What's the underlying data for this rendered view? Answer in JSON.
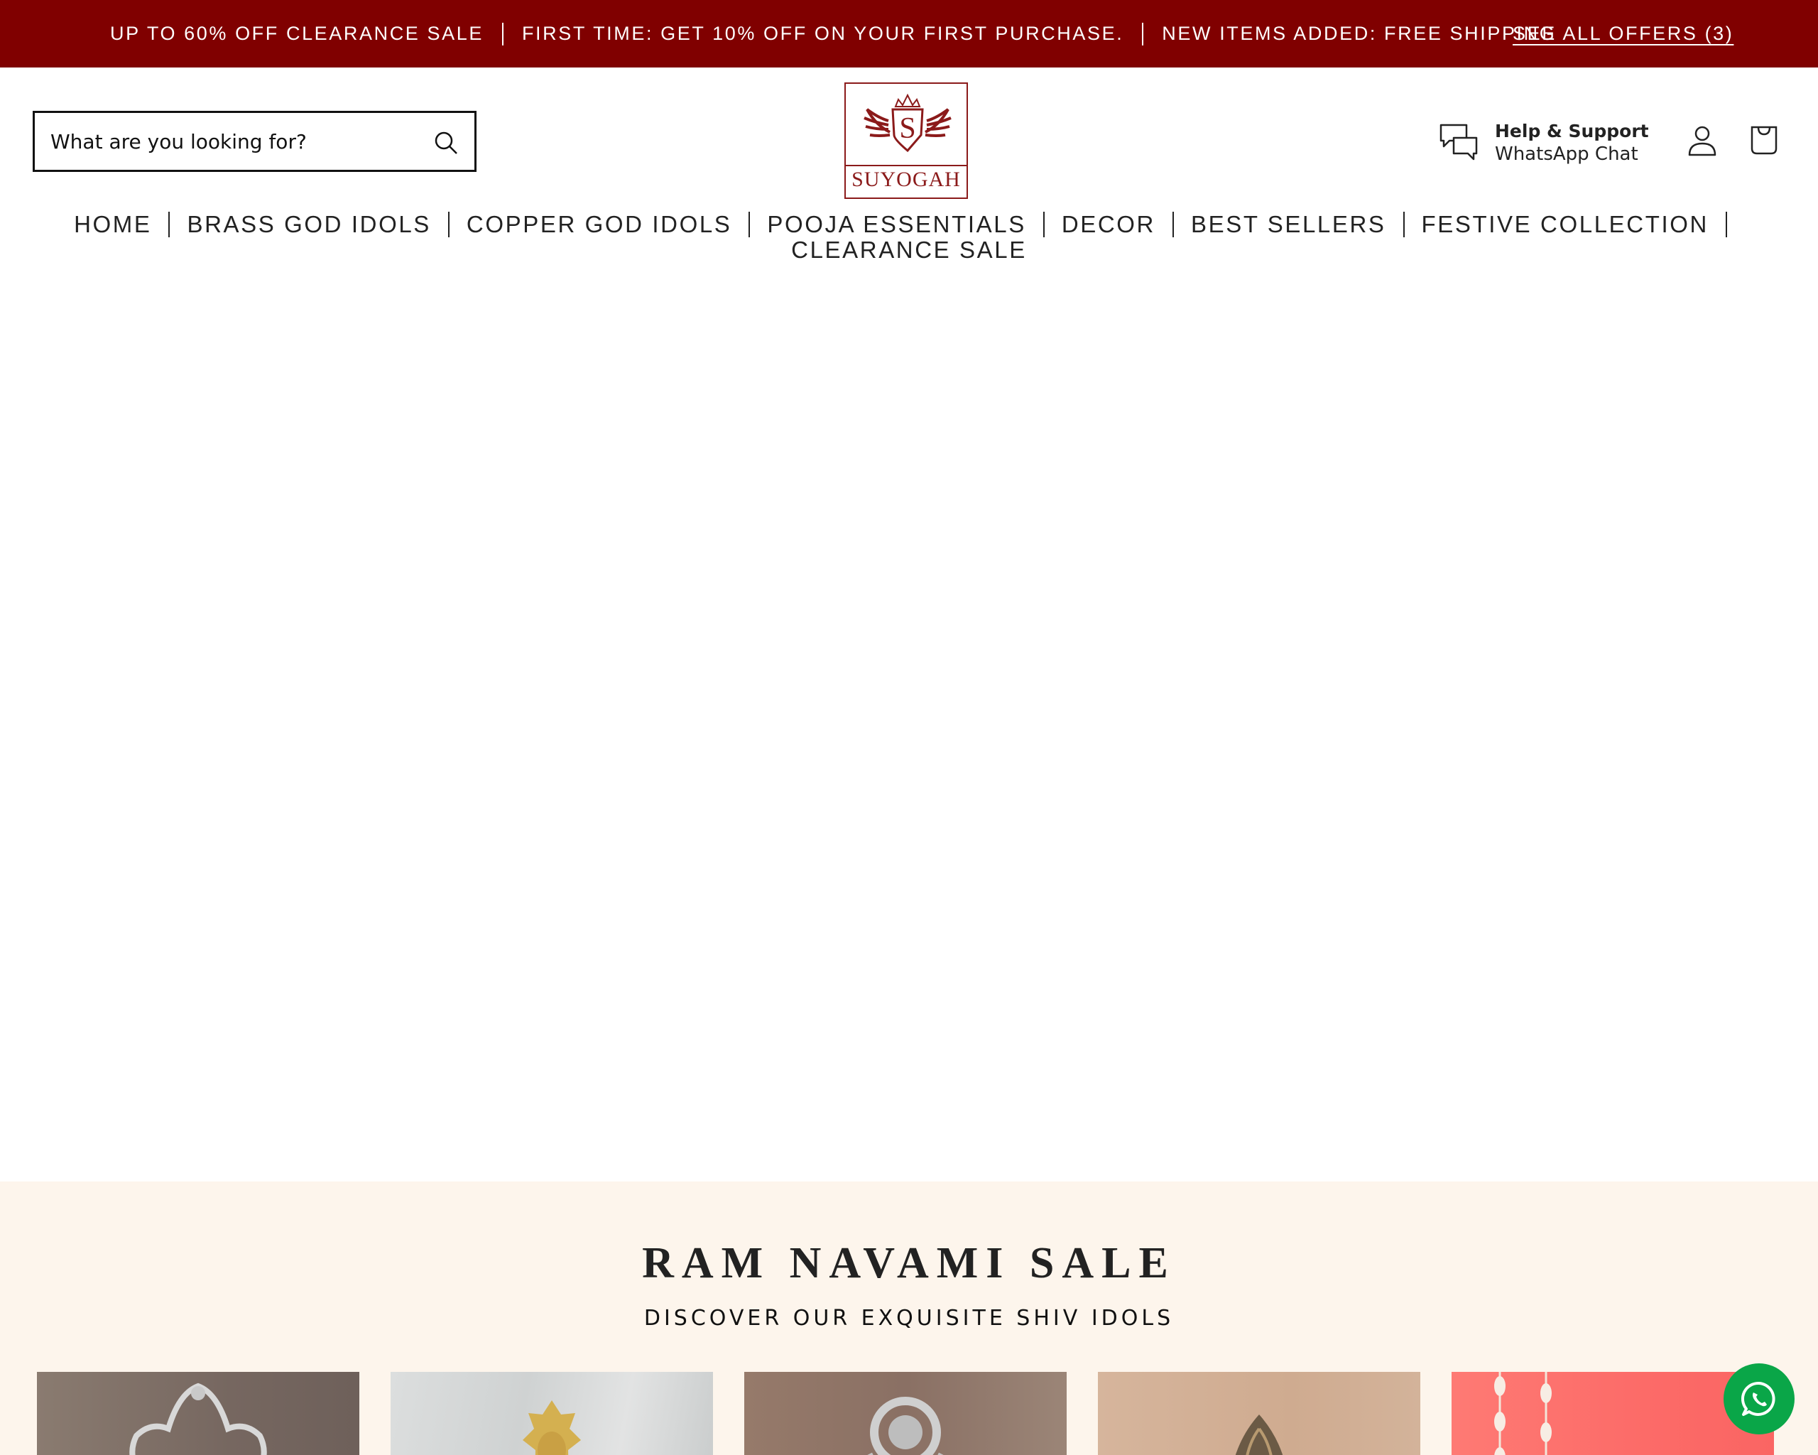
{
  "announcement": {
    "messages": [
      "UP TO 60% OFF CLEARANCE SALE",
      "FIRST TIME: GET 10% OFF ON YOUR FIRST PURCHASE.",
      "NEW ITEMS ADDED: FREE SHIPPING"
    ],
    "offers_link": "SEE ALL OFFERS (3)",
    "bg_color": "#800000"
  },
  "header": {
    "search": {
      "placeholder": "What are you looking for?",
      "value": "",
      "icon": "search-icon"
    },
    "logo": {
      "brand": "SUYOGAH",
      "monogram": "S",
      "color": "#8b1a1a"
    },
    "support": {
      "title": "Help & Support",
      "subtitle": "WhatsApp Chat",
      "icon": "chat-bubbles-icon"
    },
    "account_icon": "user-icon",
    "cart_icon": "shopping-bag-icon"
  },
  "nav": {
    "items": [
      "HOME",
      "BRASS GOD IDOLS",
      "COPPER GOD IDOLS",
      "POOJA ESSENTIALS",
      "DECOR",
      "BEST SELLERS",
      "FESTIVE COLLECTION",
      "CLEARANCE SALE"
    ]
  },
  "promo": {
    "title": "RAM NAVAMI SALE",
    "subtitle": "DISCOVER OUR EXQUISITE SHIV IDOLS",
    "bg_color": "#fdf5ec",
    "products": [
      {
        "alt": "Silver-finish idol with ornate arch",
        "bg": "#7d6e64"
      },
      {
        "alt": "Brass sun-face idol on marble",
        "bg": "#d9d9d9"
      },
      {
        "alt": "Silver sun-face wall idol",
        "bg": "#8e7668"
      },
      {
        "alt": "Brass ornate kireetam idol",
        "bg": "#d2b096"
      },
      {
        "alt": "Idol with floral garlands on pink",
        "bg": "#fb6b6b"
      }
    ]
  },
  "whatsapp_button": {
    "icon": "whatsapp-icon",
    "color": "#0aa648"
  }
}
